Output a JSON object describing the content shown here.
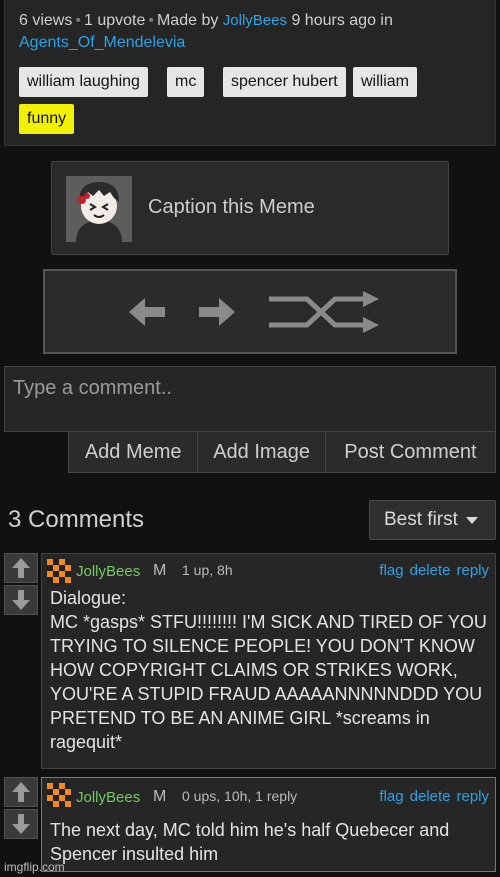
{
  "post": {
    "views": "6 views",
    "upvotes": "1 upvote",
    "made_by_prefix": "Made by",
    "author": "JollyBees",
    "time": "9 hours ago in",
    "community": "Agents_Of_Mendelevia",
    "tags": [
      "william laughing",
      "mc",
      "spencer hubert",
      "william",
      "funny"
    ]
  },
  "caption": {
    "label": "Caption this Meme"
  },
  "comment_input": {
    "placeholder": "Type a comment.."
  },
  "actions": {
    "add_meme": "Add Meme",
    "add_image": "Add Image",
    "post_comment": "Post Comment"
  },
  "comments_header": {
    "count_label": "3 Comments",
    "sort_selected": "Best first"
  },
  "comments": [
    {
      "user": "JollyBees",
      "role": "M",
      "stats": "1 up, 8h",
      "text": "Dialogue:\nMC *gasps* STFU!!!!!!!! I'M SICK AND TIRED OF YOU TRYING TO SILENCE PEOPLE! YOU DON'T KNOW HOW COPYRIGHT CLAIMS OR STRIKES WORK, YOU'RE A STUPID FRAUD AAAAANNNNNDDD YOU PRETEND TO BE AN ANIME GIRL *screams in ragequit*",
      "flag": "flag",
      "delete": "delete",
      "reply": "reply"
    },
    {
      "user": "JollyBees",
      "role": "M",
      "stats": "0 ups, 10h, 1 reply",
      "text": "The next day, MC told him he's half Quebecer and Spencer insulted him",
      "flag": "flag",
      "delete": "delete",
      "reply": "reply"
    }
  ],
  "watermark": "imgflip.com",
  "colors": {
    "link": "#2aa3e6",
    "username": "#6fcd5c",
    "tag_highlight": "#f2f200",
    "background": "#111111"
  }
}
